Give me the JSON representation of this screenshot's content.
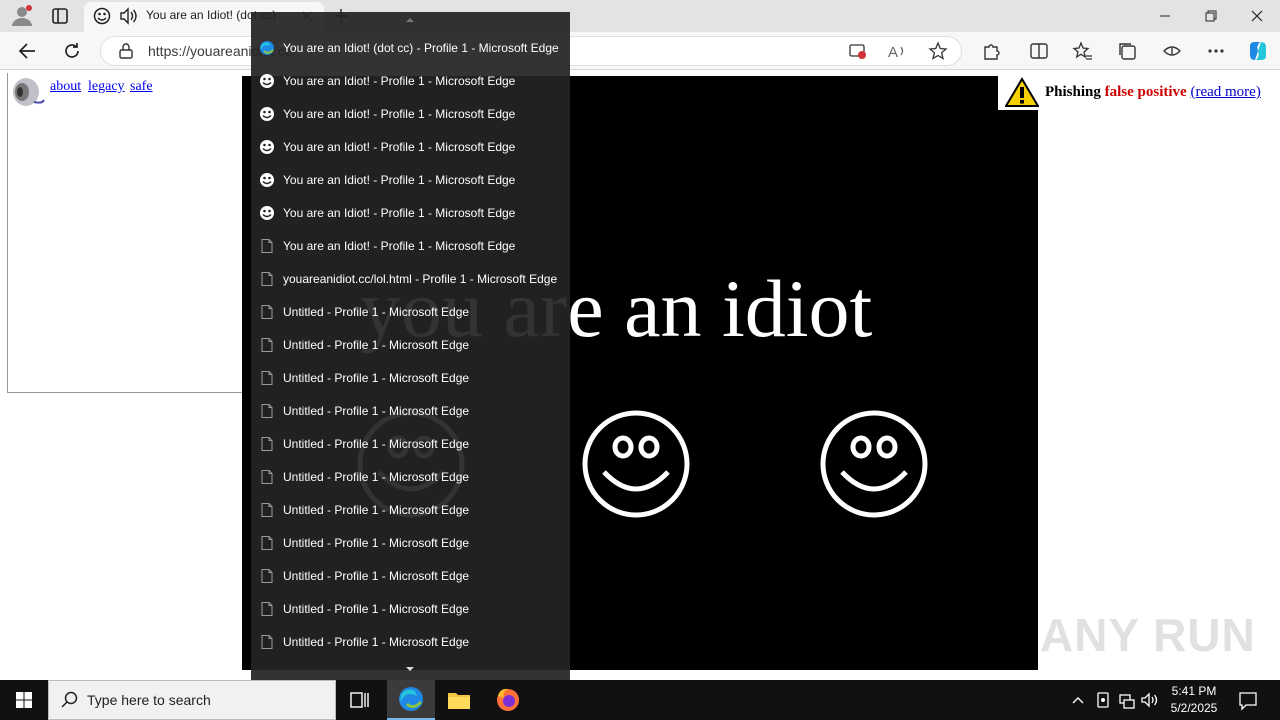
{
  "browser": {
    "tab_title": "You are an Idiot! (dot cc)",
    "url": "https://youareanidiot.cc"
  },
  "page": {
    "links": [
      "about",
      "legacy",
      "safe"
    ],
    "headline": "you are an idiot",
    "phishing": {
      "label": "Phishing",
      "flag": "false positive",
      "link": "(read more)"
    },
    "watermark": "ANY RUN"
  },
  "jumplist": {
    "items": [
      {
        "label": "You are an Idiot! (dot cc) - Profile 1 - Microsoft Edge",
        "icon": "edge-icon"
      },
      {
        "label": "You are an Idiot! - Profile 1 - Microsoft Edge",
        "icon": "smiley-icon"
      },
      {
        "label": "You are an Idiot! - Profile 1 - Microsoft Edge",
        "icon": "smiley-icon"
      },
      {
        "label": "You are an Idiot! - Profile 1 - Microsoft Edge",
        "icon": "smiley-icon"
      },
      {
        "label": "You are an Idiot! - Profile 1 - Microsoft Edge",
        "icon": "smiley-icon"
      },
      {
        "label": "You are an Idiot! - Profile 1 - Microsoft Edge",
        "icon": "smiley-icon"
      },
      {
        "label": "You are an Idiot! - Profile 1 - Microsoft Edge",
        "icon": "page-icon"
      },
      {
        "label": "youareanidiot.cc/lol.html - Profile 1 - Microsoft Edge",
        "icon": "page-icon"
      },
      {
        "label": "Untitled - Profile 1 - Microsoft Edge",
        "icon": "page-icon"
      },
      {
        "label": "Untitled - Profile 1 - Microsoft Edge",
        "icon": "page-icon"
      },
      {
        "label": "Untitled - Profile 1 - Microsoft Edge",
        "icon": "page-icon"
      },
      {
        "label": "Untitled - Profile 1 - Microsoft Edge",
        "icon": "page-icon"
      },
      {
        "label": "Untitled - Profile 1 - Microsoft Edge",
        "icon": "page-icon"
      },
      {
        "label": "Untitled - Profile 1 - Microsoft Edge",
        "icon": "page-icon"
      },
      {
        "label": "Untitled - Profile 1 - Microsoft Edge",
        "icon": "page-icon"
      },
      {
        "label": "Untitled - Profile 1 - Microsoft Edge",
        "icon": "page-icon"
      },
      {
        "label": "Untitled - Profile 1 - Microsoft Edge",
        "icon": "page-icon"
      },
      {
        "label": "Untitled - Profile 1 - Microsoft Edge",
        "icon": "page-icon"
      },
      {
        "label": "Untitled - Profile 1 - Microsoft Edge",
        "icon": "page-icon"
      }
    ]
  },
  "taskbar": {
    "search_placeholder": "Type here to search",
    "time": "5:41 PM",
    "date": "5/2/2025"
  },
  "colors": {
    "phishing_flag": "#cc0000",
    "link": "#0000ee",
    "taskbar_active": "#76b9ed"
  }
}
